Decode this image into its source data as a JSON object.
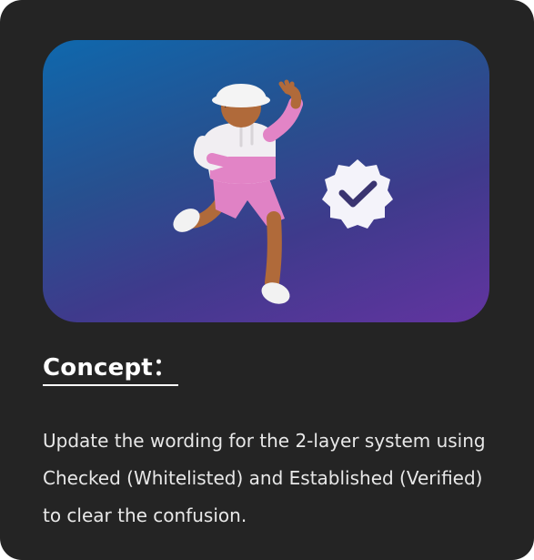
{
  "card": {
    "heading": "Concept：",
    "description": "Update the wording for the 2-layer system using Checked (Whitelisted) and Established (Verified) to clear the confusion."
  },
  "hero": {
    "illustration": "running-character-illustration",
    "badge_icon": "verified-badge-icon"
  },
  "colors": {
    "card_background": "#242424",
    "gradient_start": "#0f68ad",
    "gradient_end": "#6234a0",
    "text": "#ffffff"
  }
}
